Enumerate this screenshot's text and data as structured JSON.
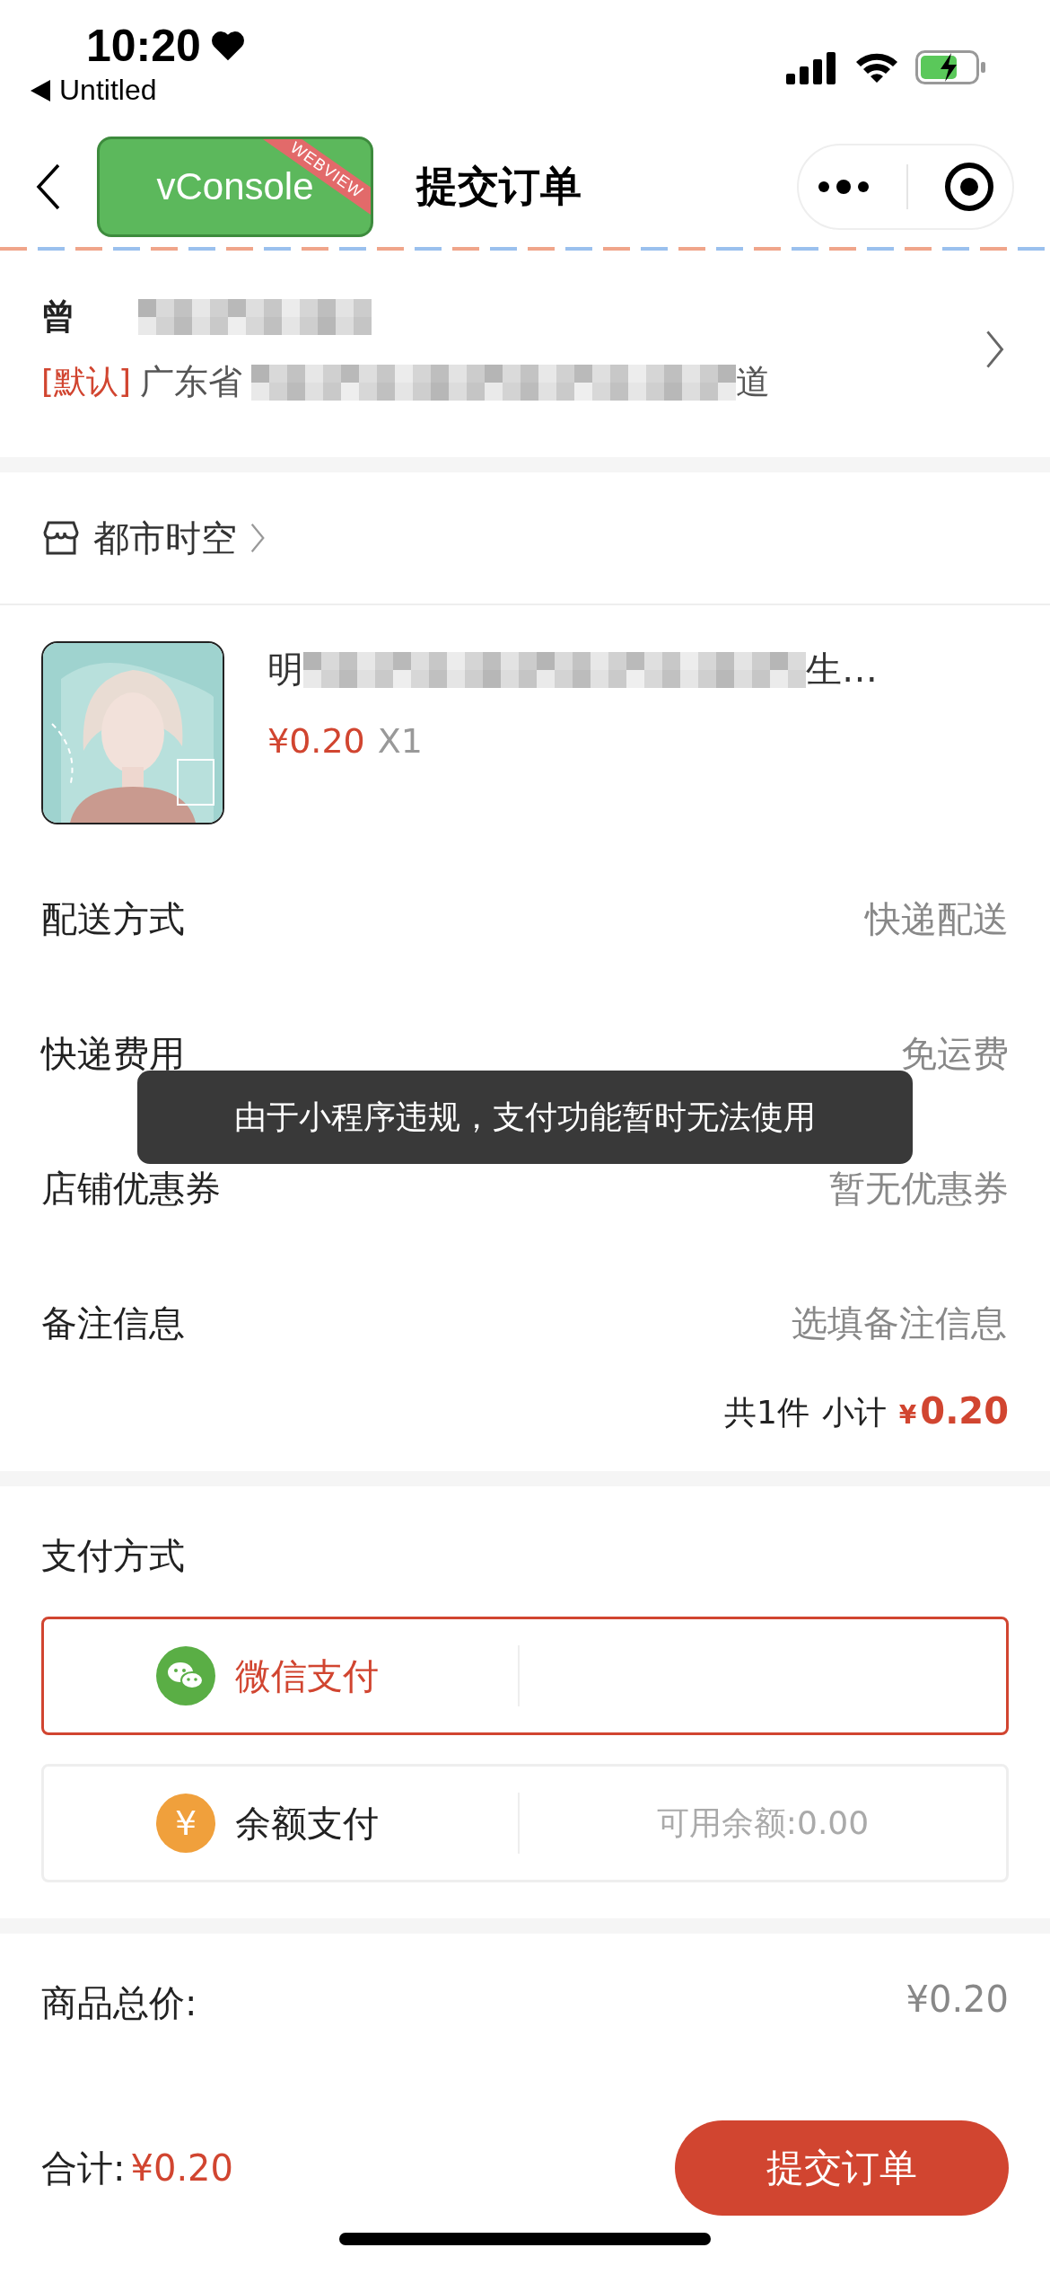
{
  "status_bar": {
    "time": "10:20",
    "back_app": "Untitled"
  },
  "nav": {
    "badge": "vConsole",
    "ribbon": "WEBVIEW",
    "title": "提交订单"
  },
  "address": {
    "name": "曾",
    "default_tag": "[默认]",
    "province": "广东省",
    "address_end": "道"
  },
  "shop": {
    "name": "都市时空"
  },
  "product": {
    "title_start": "明",
    "title_end": "生…",
    "price": "¥0.20",
    "quantity": "X1"
  },
  "fields": [
    {
      "kind": "value",
      "label": "配送方式",
      "value": "快递配送"
    },
    {
      "kind": "value",
      "label": "快递费用",
      "value": "免运费"
    },
    {
      "kind": "value",
      "label": "店铺优惠券",
      "value": "暂无优惠券"
    },
    {
      "kind": "input",
      "label": "备注信息",
      "placeholder": "选填备注信息"
    }
  ],
  "subtotal": {
    "count": "共1件",
    "label": "小计",
    "currency": "¥",
    "amount": "0.20"
  },
  "payment": {
    "title": "支付方式",
    "methods": [
      {
        "kind": "wechat",
        "label": "微信支付",
        "selected": true
      },
      {
        "kind": "balance",
        "label": "余额支付",
        "icon": "¥",
        "note": "可用余额:0.00",
        "selected": false
      }
    ]
  },
  "summary": {
    "label": "商品总价:",
    "value": "¥0.20"
  },
  "footer": {
    "total_label": "合计:",
    "total": "¥0.20",
    "submit": "提交订单"
  },
  "toast": "由于小程序违规，支付功能暂时无法使用"
}
